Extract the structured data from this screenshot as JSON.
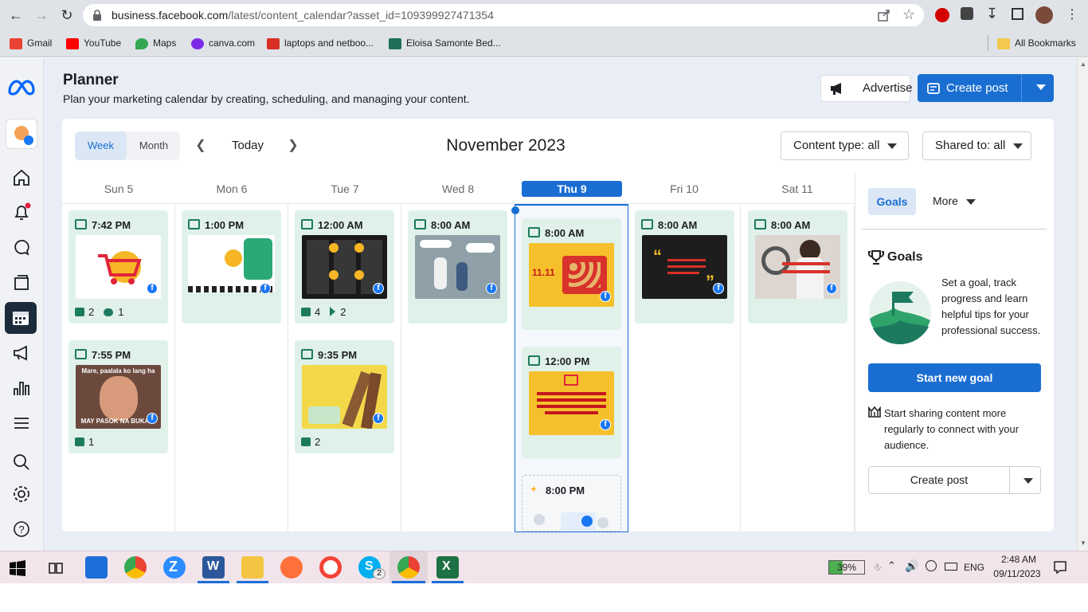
{
  "browser": {
    "url_host": "business.facebook.com",
    "url_path": "/latest/content_calendar?asset_id=109399927471354",
    "bookmarks": [
      {
        "label": "Gmail",
        "color": "#ea4335"
      },
      {
        "label": "YouTube",
        "color": "#ff0000"
      },
      {
        "label": "Maps",
        "color": "#34a853"
      },
      {
        "label": "canva.com",
        "color": "#7d2ae8"
      },
      {
        "label": "laptops and netboo...",
        "color": "#d93025"
      },
      {
        "label": "Eloisa Samonte Bed...",
        "color": "#1f6e5a"
      }
    ],
    "all_bookmarks": "All Bookmarks"
  },
  "planner": {
    "title": "Planner",
    "subtitle": "Plan your marketing calendar by creating, scheduling, and managing your content.",
    "advertise": "Advertise",
    "create_post": "Create post"
  },
  "calendar": {
    "view_week": "Week",
    "view_month": "Month",
    "today": "Today",
    "month_title": "November 2023",
    "content_type": "Content type: all",
    "shared_to": "Shared to: all",
    "days": [
      "Sun 5",
      "Mon 6",
      "Tue 7",
      "Wed 8",
      "Thu 9",
      "Fri 10",
      "Sat 11"
    ],
    "posts": {
      "sun1": {
        "time": "7:42 PM",
        "likes": "2",
        "comments": "1"
      },
      "sun2": {
        "time": "7:55 PM",
        "likes": "1",
        "meme_top": "Mare, paalala ko lang ha",
        "meme_bottom": "MAY PASOK NA BUKAS!"
      },
      "mon1": {
        "time": "1:00 PM"
      },
      "tue1": {
        "time": "12:00 AM",
        "likes": "4",
        "shares": "2"
      },
      "tue2": {
        "time": "9:35 PM",
        "likes": "2"
      },
      "wed1": {
        "time": "8:00 AM"
      },
      "thu1": {
        "time": "8:00 AM",
        "promo": "11.11"
      },
      "thu2": {
        "time": "12:00 PM"
      },
      "thu3": {
        "time": "8:00 PM"
      },
      "fri1": {
        "time": "8:00 AM"
      },
      "sat1": {
        "time": "8:00 AM"
      }
    }
  },
  "side_panel": {
    "tab_goals": "Goals",
    "tab_more": "More",
    "goals_title": "Goals",
    "goals_desc": "Set a goal, track progress and learn helpful tips for your professional success.",
    "start_goal": "Start new goal",
    "share_text": "Start sharing content more regularly to connect with your audience.",
    "create_post": "Create post"
  },
  "taskbar": {
    "battery": "39%",
    "lang": "ENG",
    "time": "2:48 AM",
    "date": "09/11/2023",
    "skype_badge": "2"
  },
  "colors": {
    "accent": "#1a6ed2",
    "post_bg": "#e0f1ea",
    "post_icon": "#1d7a5f"
  }
}
